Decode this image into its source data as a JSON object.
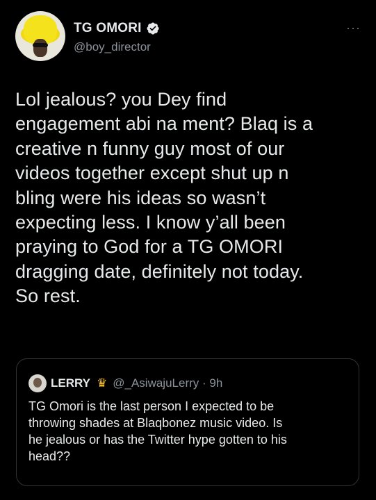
{
  "tweet": {
    "display_name": "TG OMORI",
    "handle": "@boy_director",
    "more": "···",
    "text": "Lol jealous? you Dey find\nengagement abi na ment? Blaq is a\ncreative n funny guy most of our\nvideos together except shut up n\nbling were his ideas so wasn’t\nexpecting less. I know y’all been\npraying to God for a TG OMORI\ndragging date, definitely not today.\nSo rest.",
    "verified_icon": "verified-badge-icon"
  },
  "quoted": {
    "display_name": "LERRY",
    "emoji_icon": "crown-icon",
    "handle_time": "@_AsiwajuLerry · 9h",
    "text": "TG Omori is the last person I expected to be\nthrowing shades at Blaqbonez music video. Is\nhe jealous or has the Twitter hype gotten to his\nhead??"
  },
  "colors": {
    "background": "#000000",
    "text": "#e7e9ea",
    "secondary": "#8b9199",
    "border": "#2f3336"
  }
}
